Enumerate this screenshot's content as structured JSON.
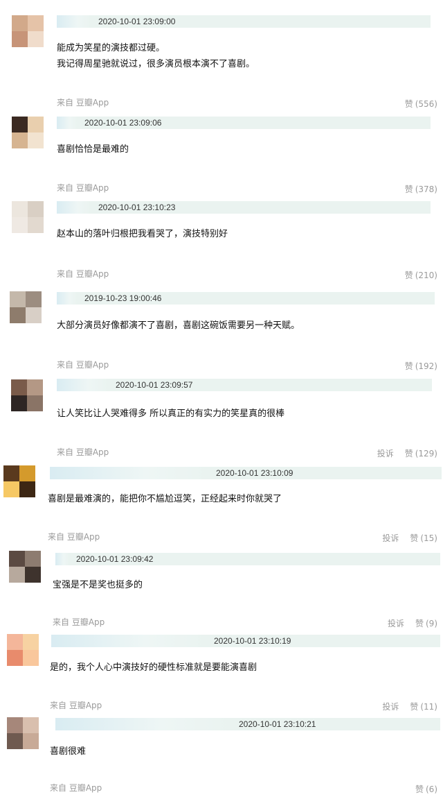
{
  "comments": [
    {
      "timestamp": "2020-10-01 23:09:00",
      "lines": [
        "能成为笑星的演技都过硬。",
        "我记得周星驰就说过，很多演员根本演不了喜剧。"
      ],
      "source": "来自 豆瓣App",
      "like_label": "赞",
      "like_count": "(556)",
      "report_label": ""
    },
    {
      "timestamp": "2020-10-01 23:09:06",
      "lines": [
        "喜剧恰恰是最难的"
      ],
      "source": "来自 豆瓣App",
      "like_label": "赞",
      "like_count": "(378)",
      "report_label": ""
    },
    {
      "timestamp": "2020-10-01 23:10:23",
      "lines": [
        "赵本山的落叶归根把我看哭了，演技特别好"
      ],
      "source": "来自 豆瓣App",
      "like_label": "赞",
      "like_count": "(210)",
      "report_label": ""
    },
    {
      "timestamp": "2019-10-23 19:00:46",
      "lines": [
        "大部分演员好像都演不了喜剧，喜剧这碗饭需要另一种天赋。"
      ],
      "source": "来自 豆瓣App",
      "like_label": "赞",
      "like_count": "(192)",
      "report_label": ""
    },
    {
      "timestamp": "2020-10-01 23:09:57",
      "lines": [
        "让人笑比让人哭难得多 所以真正的有实力的笑星真的很棒"
      ],
      "source": "来自 豆瓣App",
      "like_label": "赞",
      "like_count": "(129)",
      "report_label": "投诉"
    },
    {
      "timestamp": "2020-10-01 23:10:09",
      "lines": [
        "喜剧是最难演的，能把你不尴尬逗笑，正经起来时你就哭了"
      ],
      "source": "来自 豆瓣App",
      "like_label": "赞",
      "like_count": "(15)",
      "report_label": "投诉"
    },
    {
      "timestamp": "2020-10-01 23:09:42",
      "lines": [
        "宝强是不是奖也挺多的"
      ],
      "source": "来自 豆瓣App",
      "like_label": "赞",
      "like_count": "(9)",
      "report_label": "投诉"
    },
    {
      "timestamp": "2020-10-01 23:10:19",
      "lines": [
        "是的，我个人心中演技好的硬性标准就是要能演喜剧"
      ],
      "source": "来自 豆瓣App",
      "like_label": "赞",
      "like_count": "(11)",
      "report_label": "投诉"
    },
    {
      "timestamp": "2020-10-01 23:10:21",
      "lines": [
        "喜剧很难"
      ],
      "source": "来自 豆瓣App",
      "like_label": "赞",
      "like_count": "(6)",
      "report_label": ""
    }
  ],
  "colors": {
    "meta_bar_bg": "#eaf3f0",
    "muted_text": "#9a9a9a",
    "body_text": "#111111"
  }
}
